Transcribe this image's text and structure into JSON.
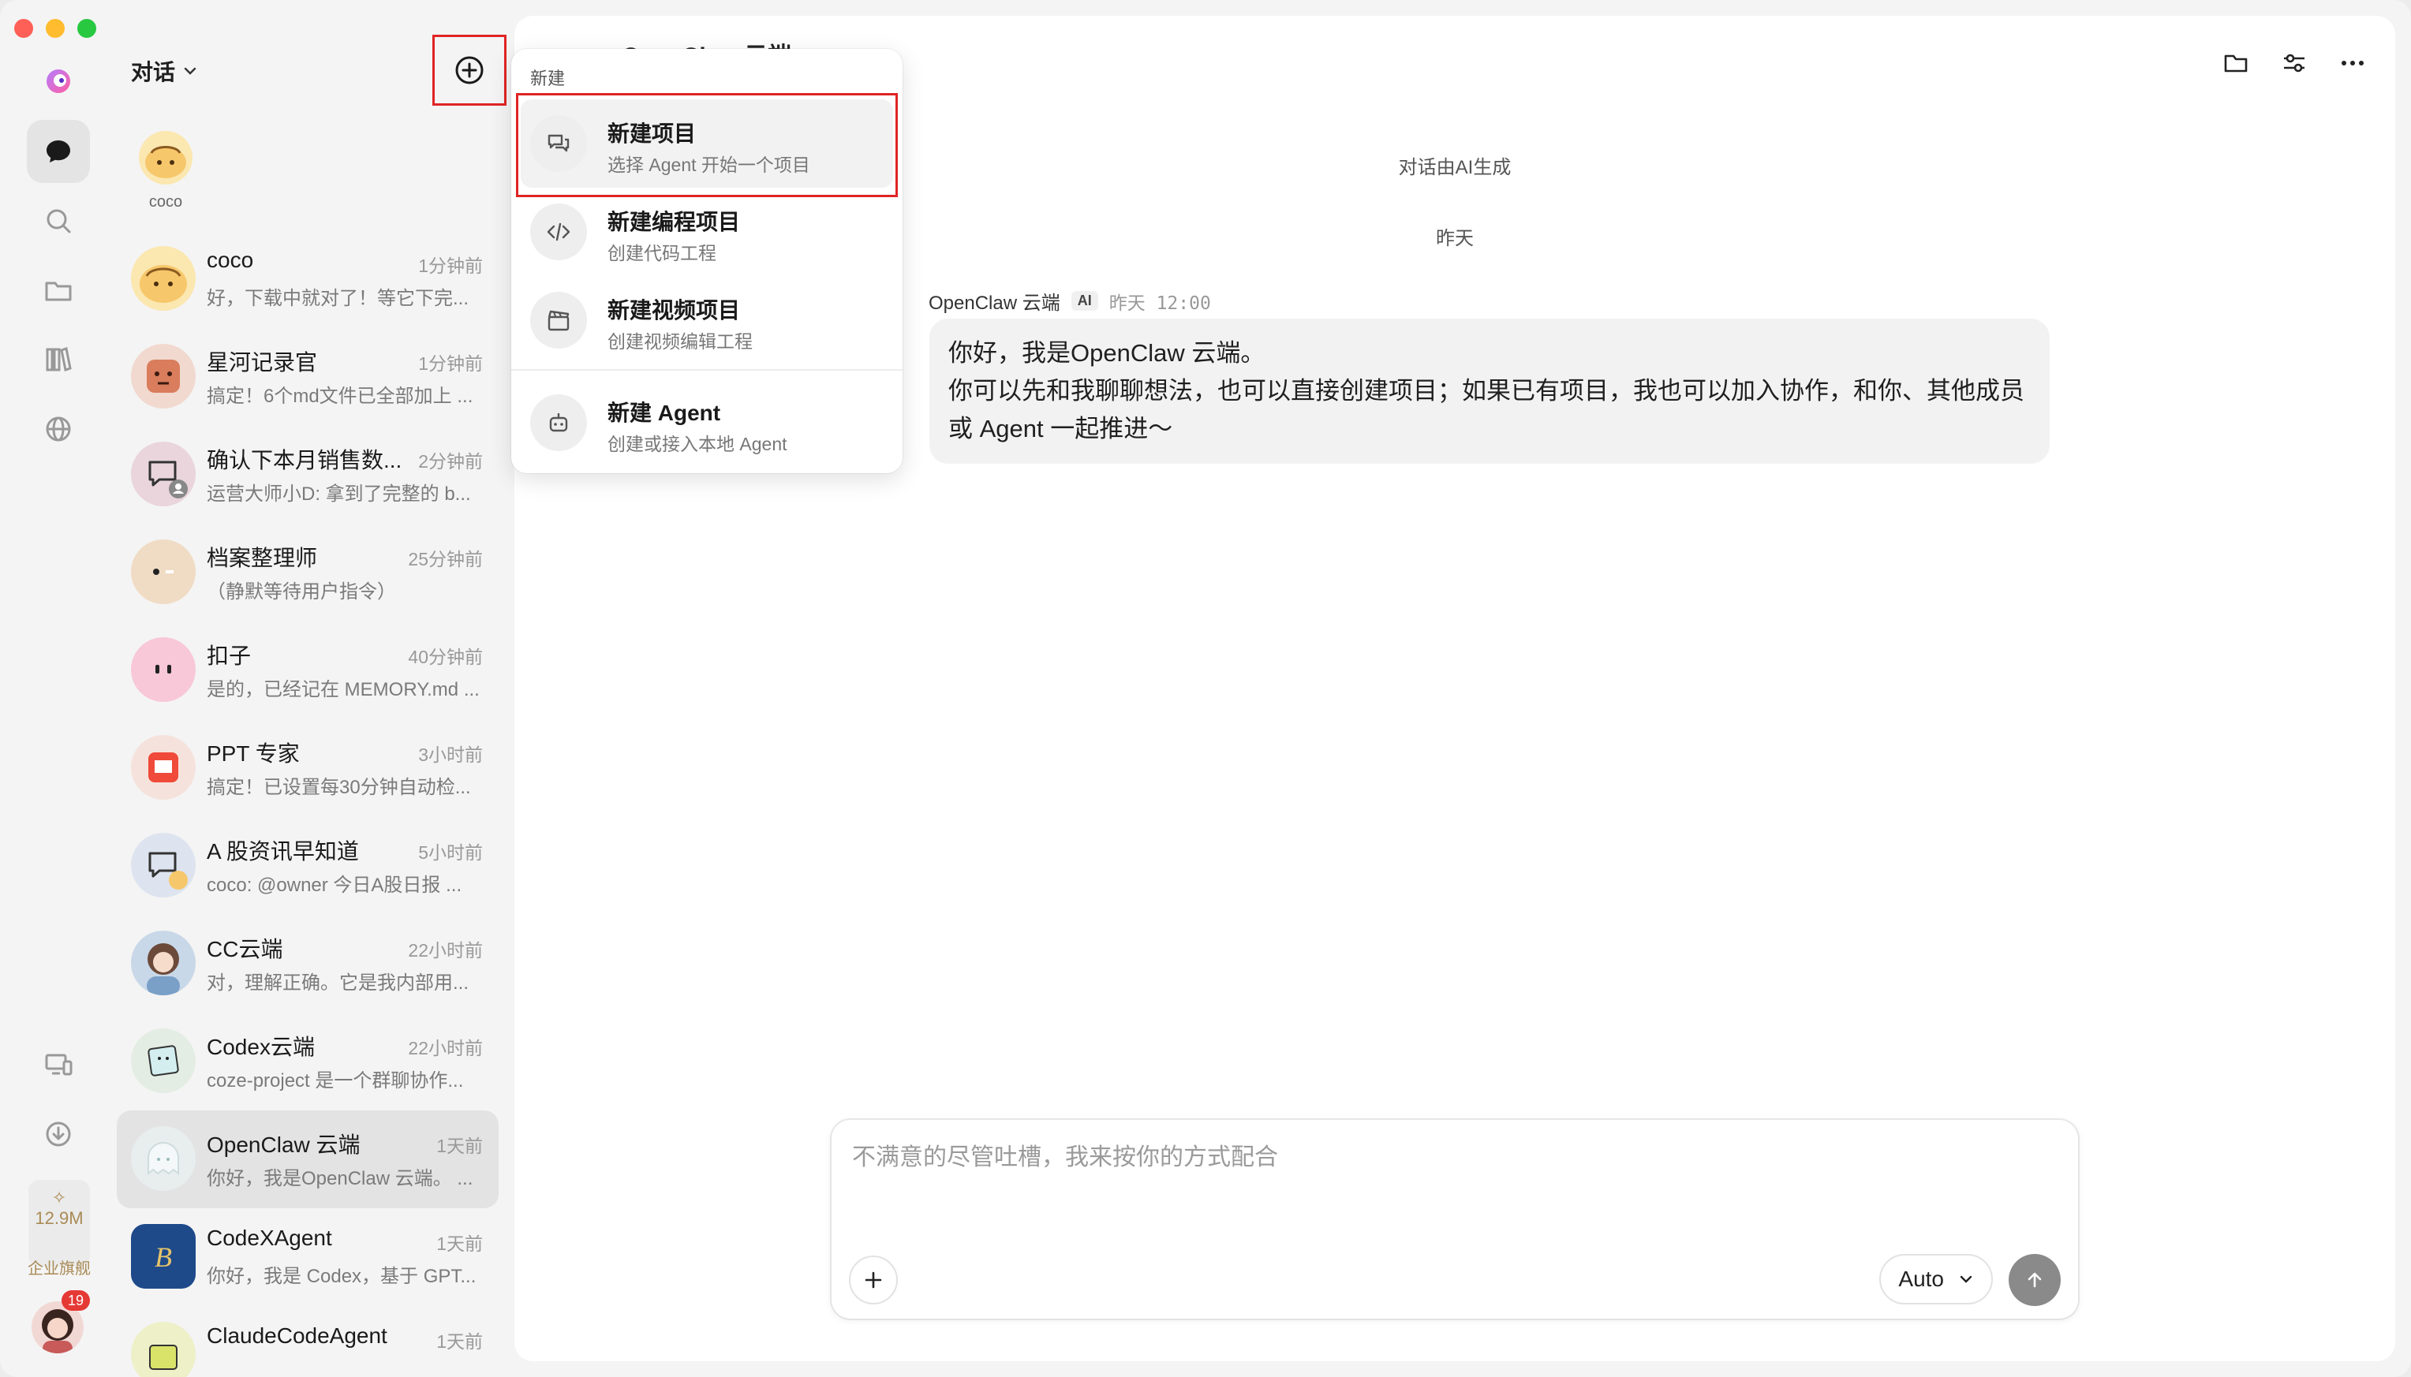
{
  "sidebar": {
    "title": "对话",
    "pinned": {
      "name": "coco"
    },
    "conversations": [
      {
        "name": "coco",
        "time": "1分钟前",
        "preview": "好，下载中就对了！等它下完..."
      },
      {
        "name": "星河记录官",
        "time": "1分钟前",
        "preview": "搞定！6个md文件已全部加上 ..."
      },
      {
        "name": "确认下本月销售数...",
        "time": "2分钟前",
        "preview": "运营大师小D: 拿到了完整的 b..."
      },
      {
        "name": "档案整理师",
        "time": "25分钟前",
        "preview": "（静默等待用户指令）"
      },
      {
        "name": "扣子",
        "time": "40分钟前",
        "preview": "是的，已经记在 MEMORY.md ..."
      },
      {
        "name": "PPT 专家",
        "time": "3小时前",
        "preview": "搞定！已设置每30分钟自动检..."
      },
      {
        "name": "A 股资讯早知道",
        "time": "5小时前",
        "preview": "coco: @owner 今日A股日报 ..."
      },
      {
        "name": "CC云端",
        "time": "22小时前",
        "preview": "对，理解正确。它是我内部用..."
      },
      {
        "name": "Codex云端",
        "time": "22小时前",
        "preview": "coze-project 是一个群聊协作..."
      },
      {
        "name": "OpenClaw 云端",
        "time": "1天前",
        "preview": "你好，我是OpenClaw 云端。 ..."
      },
      {
        "name": "CodeXAgent",
        "time": "1天前",
        "preview": "你好，我是 Codex，基于 GPT..."
      },
      {
        "name": "ClaudeCodeAgent",
        "time": "1天前",
        "preview": ""
      }
    ]
  },
  "rail": {
    "quota": "12.9M",
    "enterprise_label": "企业旗舰",
    "notification_count": "19"
  },
  "dropdown": {
    "header": "新建",
    "items": [
      {
        "title": "新建项目",
        "subtitle": "选择 Agent 开始一个项目"
      },
      {
        "title": "新建编程项目",
        "subtitle": "创建代码工程"
      },
      {
        "title": "新建视频项目",
        "subtitle": "创建视频编辑工程"
      },
      {
        "title": "新建 Agent",
        "subtitle": "创建或接入本地 Agent"
      }
    ]
  },
  "chat": {
    "title": "OpenClaw 云端",
    "ai_note": "对话由AI生成",
    "date_divider": "昨天",
    "message": {
      "sender": "OpenClaw 云端",
      "badge": "AI",
      "time": "昨天 12:00",
      "line1": "你好，我是OpenClaw 云端。",
      "line2": "你可以先和我聊聊想法，也可以直接创建项目；如果已有项目，我也可以加入协作，和你、其他成员或 Agent 一起推进～"
    }
  },
  "composer": {
    "placeholder": "不满意的尽管吐槽，我来按你的方式配合",
    "model": "Auto"
  }
}
